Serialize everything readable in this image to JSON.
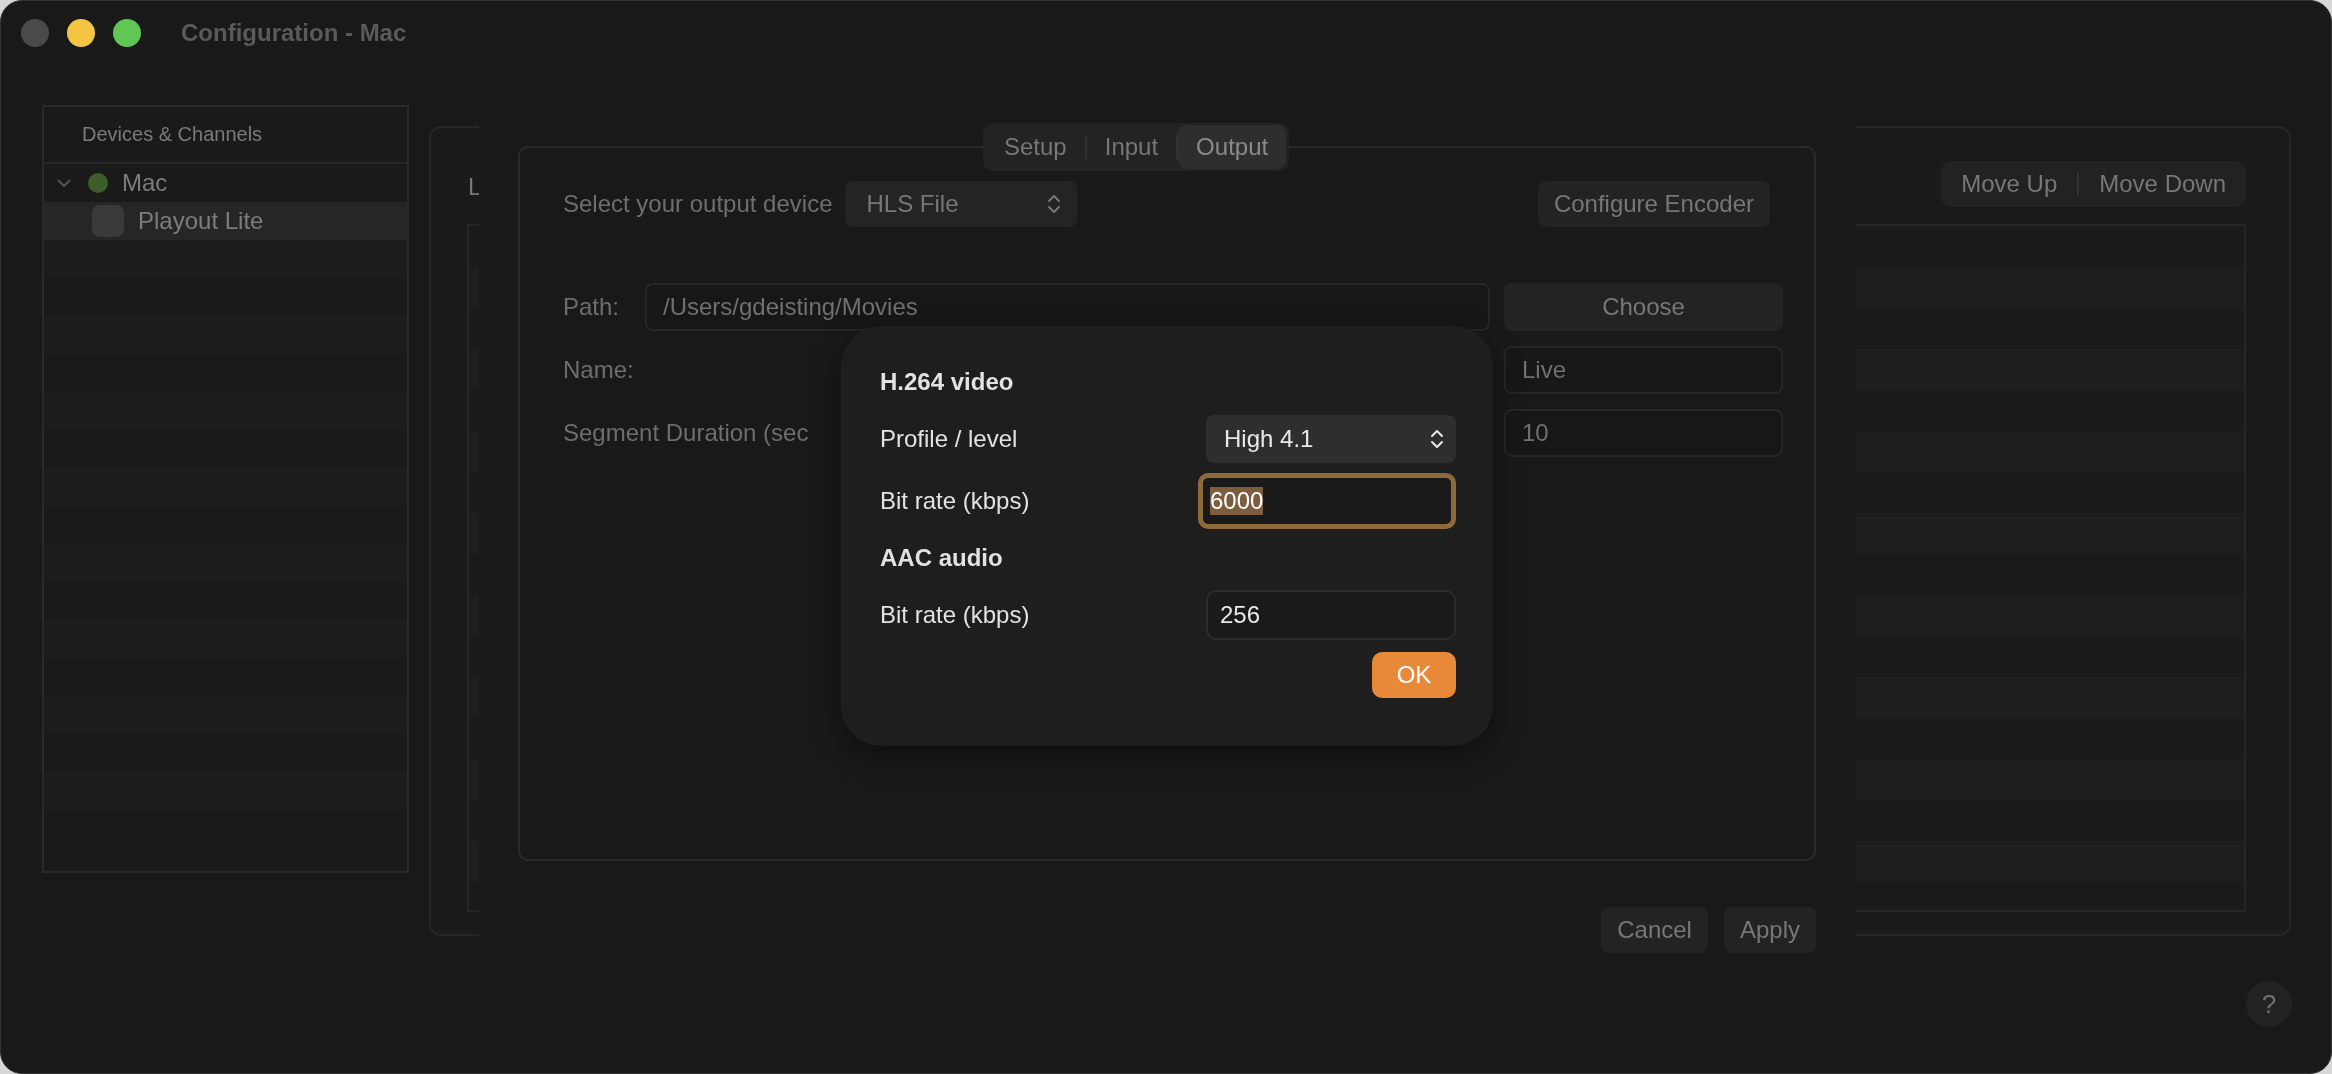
{
  "window": {
    "title": "Configuration - Mac"
  },
  "sidebar": {
    "header": "Devices & Channels",
    "items": [
      {
        "label": "Mac",
        "expanded": true,
        "selected": false,
        "color": "#3f5d2a",
        "children": [
          {
            "label": "Playout Lite",
            "selected": true
          }
        ]
      }
    ]
  },
  "back_panel": {
    "cut_label": "L",
    "buttons": [
      "Move Up",
      "Move Down"
    ]
  },
  "sheet": {
    "tabs": [
      {
        "label": "Setup",
        "selected": false
      },
      {
        "label": "Input",
        "selected": false
      },
      {
        "label": "Output",
        "selected": true
      }
    ],
    "output_device": {
      "label": "Select your output device",
      "value": "HLS File"
    },
    "configure_button": "Configure Encoder",
    "path": {
      "label": "Path:",
      "value": "/Users/gdeisting/Movies",
      "button": "Choose"
    },
    "fields": [
      {
        "label": "Name:",
        "value": "Live"
      },
      {
        "label": "Segment Duration (sec",
        "value": "10"
      }
    ],
    "buttons": [
      "Cancel",
      "Apply"
    ]
  },
  "popover": {
    "sections": [
      {
        "title": "H.264 video",
        "rows": [
          {
            "kind": "popup",
            "label": "Profile / level",
            "value": "High 4.1"
          },
          {
            "kind": "field",
            "label": "Bit rate (kbps)",
            "value": "6000",
            "focused": true
          }
        ]
      },
      {
        "title": "AAC audio",
        "rows": [
          {
            "kind": "field",
            "label": "Bit rate (kbps)",
            "value": "256",
            "focused": false
          }
        ]
      }
    ],
    "ok": "OK"
  },
  "help": "?"
}
